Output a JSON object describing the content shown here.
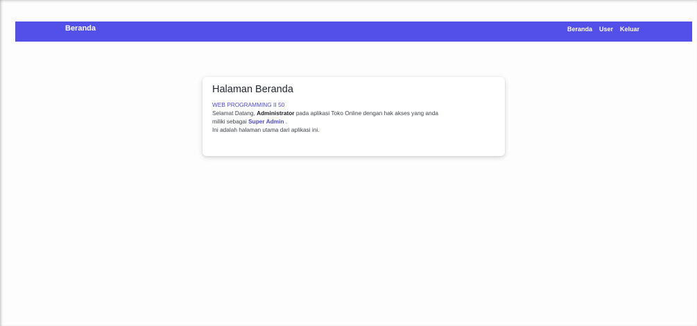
{
  "navbar": {
    "brand": "Beranda",
    "links": [
      {
        "label": "Beranda"
      },
      {
        "label": "User"
      },
      {
        "label": "Keluar"
      }
    ],
    "color": "#5350e9"
  },
  "card": {
    "title": "Halaman Beranda",
    "subtitle": "WEB PROGRAMMING II 50",
    "greeting_prefix": "Selamat Datang, ",
    "user_name": "Administrator",
    "greeting_mid": " pada aplikasi Toko Online dengan hak akses yang anda",
    "greeting_line2_prefix": "miliki sebagai ",
    "role": "Super Admin",
    "greeting_line2_suffix": " .",
    "description": "Ini adalah halaman utama dari aplikasi ini."
  }
}
